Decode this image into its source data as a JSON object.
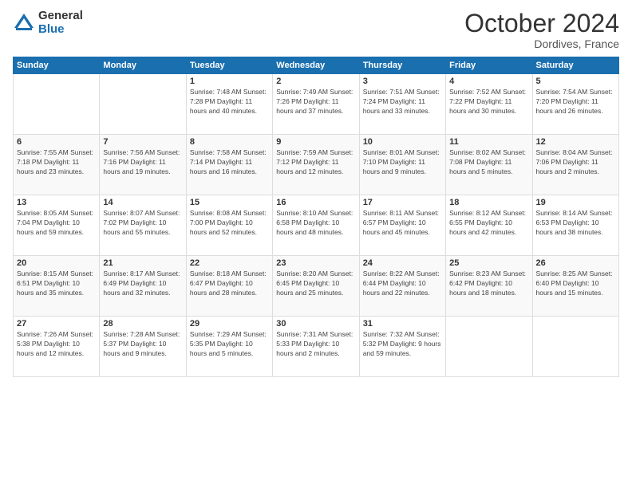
{
  "logo": {
    "general": "General",
    "blue": "Blue"
  },
  "title": "October 2024",
  "location": "Dordives, France",
  "days_of_week": [
    "Sunday",
    "Monday",
    "Tuesday",
    "Wednesday",
    "Thursday",
    "Friday",
    "Saturday"
  ],
  "weeks": [
    [
      {
        "day": "",
        "info": ""
      },
      {
        "day": "",
        "info": ""
      },
      {
        "day": "1",
        "info": "Sunrise: 7:48 AM\nSunset: 7:28 PM\nDaylight: 11 hours\nand 40 minutes."
      },
      {
        "day": "2",
        "info": "Sunrise: 7:49 AM\nSunset: 7:26 PM\nDaylight: 11 hours\nand 37 minutes."
      },
      {
        "day": "3",
        "info": "Sunrise: 7:51 AM\nSunset: 7:24 PM\nDaylight: 11 hours\nand 33 minutes."
      },
      {
        "day": "4",
        "info": "Sunrise: 7:52 AM\nSunset: 7:22 PM\nDaylight: 11 hours\nand 30 minutes."
      },
      {
        "day": "5",
        "info": "Sunrise: 7:54 AM\nSunset: 7:20 PM\nDaylight: 11 hours\nand 26 minutes."
      }
    ],
    [
      {
        "day": "6",
        "info": "Sunrise: 7:55 AM\nSunset: 7:18 PM\nDaylight: 11 hours\nand 23 minutes."
      },
      {
        "day": "7",
        "info": "Sunrise: 7:56 AM\nSunset: 7:16 PM\nDaylight: 11 hours\nand 19 minutes."
      },
      {
        "day": "8",
        "info": "Sunrise: 7:58 AM\nSunset: 7:14 PM\nDaylight: 11 hours\nand 16 minutes."
      },
      {
        "day": "9",
        "info": "Sunrise: 7:59 AM\nSunset: 7:12 PM\nDaylight: 11 hours\nand 12 minutes."
      },
      {
        "day": "10",
        "info": "Sunrise: 8:01 AM\nSunset: 7:10 PM\nDaylight: 11 hours\nand 9 minutes."
      },
      {
        "day": "11",
        "info": "Sunrise: 8:02 AM\nSunset: 7:08 PM\nDaylight: 11 hours\nand 5 minutes."
      },
      {
        "day": "12",
        "info": "Sunrise: 8:04 AM\nSunset: 7:06 PM\nDaylight: 11 hours\nand 2 minutes."
      }
    ],
    [
      {
        "day": "13",
        "info": "Sunrise: 8:05 AM\nSunset: 7:04 PM\nDaylight: 10 hours\nand 59 minutes."
      },
      {
        "day": "14",
        "info": "Sunrise: 8:07 AM\nSunset: 7:02 PM\nDaylight: 10 hours\nand 55 minutes."
      },
      {
        "day": "15",
        "info": "Sunrise: 8:08 AM\nSunset: 7:00 PM\nDaylight: 10 hours\nand 52 minutes."
      },
      {
        "day": "16",
        "info": "Sunrise: 8:10 AM\nSunset: 6:58 PM\nDaylight: 10 hours\nand 48 minutes."
      },
      {
        "day": "17",
        "info": "Sunrise: 8:11 AM\nSunset: 6:57 PM\nDaylight: 10 hours\nand 45 minutes."
      },
      {
        "day": "18",
        "info": "Sunrise: 8:12 AM\nSunset: 6:55 PM\nDaylight: 10 hours\nand 42 minutes."
      },
      {
        "day": "19",
        "info": "Sunrise: 8:14 AM\nSunset: 6:53 PM\nDaylight: 10 hours\nand 38 minutes."
      }
    ],
    [
      {
        "day": "20",
        "info": "Sunrise: 8:15 AM\nSunset: 6:51 PM\nDaylight: 10 hours\nand 35 minutes."
      },
      {
        "day": "21",
        "info": "Sunrise: 8:17 AM\nSunset: 6:49 PM\nDaylight: 10 hours\nand 32 minutes."
      },
      {
        "day": "22",
        "info": "Sunrise: 8:18 AM\nSunset: 6:47 PM\nDaylight: 10 hours\nand 28 minutes."
      },
      {
        "day": "23",
        "info": "Sunrise: 8:20 AM\nSunset: 6:45 PM\nDaylight: 10 hours\nand 25 minutes."
      },
      {
        "day": "24",
        "info": "Sunrise: 8:22 AM\nSunset: 6:44 PM\nDaylight: 10 hours\nand 22 minutes."
      },
      {
        "day": "25",
        "info": "Sunrise: 8:23 AM\nSunset: 6:42 PM\nDaylight: 10 hours\nand 18 minutes."
      },
      {
        "day": "26",
        "info": "Sunrise: 8:25 AM\nSunset: 6:40 PM\nDaylight: 10 hours\nand 15 minutes."
      }
    ],
    [
      {
        "day": "27",
        "info": "Sunrise: 7:26 AM\nSunset: 5:38 PM\nDaylight: 10 hours\nand 12 minutes."
      },
      {
        "day": "28",
        "info": "Sunrise: 7:28 AM\nSunset: 5:37 PM\nDaylight: 10 hours\nand 9 minutes."
      },
      {
        "day": "29",
        "info": "Sunrise: 7:29 AM\nSunset: 5:35 PM\nDaylight: 10 hours\nand 5 minutes."
      },
      {
        "day": "30",
        "info": "Sunrise: 7:31 AM\nSunset: 5:33 PM\nDaylight: 10 hours\nand 2 minutes."
      },
      {
        "day": "31",
        "info": "Sunrise: 7:32 AM\nSunset: 5:32 PM\nDaylight: 9 hours\nand 59 minutes."
      },
      {
        "day": "",
        "info": ""
      },
      {
        "day": "",
        "info": ""
      }
    ]
  ]
}
